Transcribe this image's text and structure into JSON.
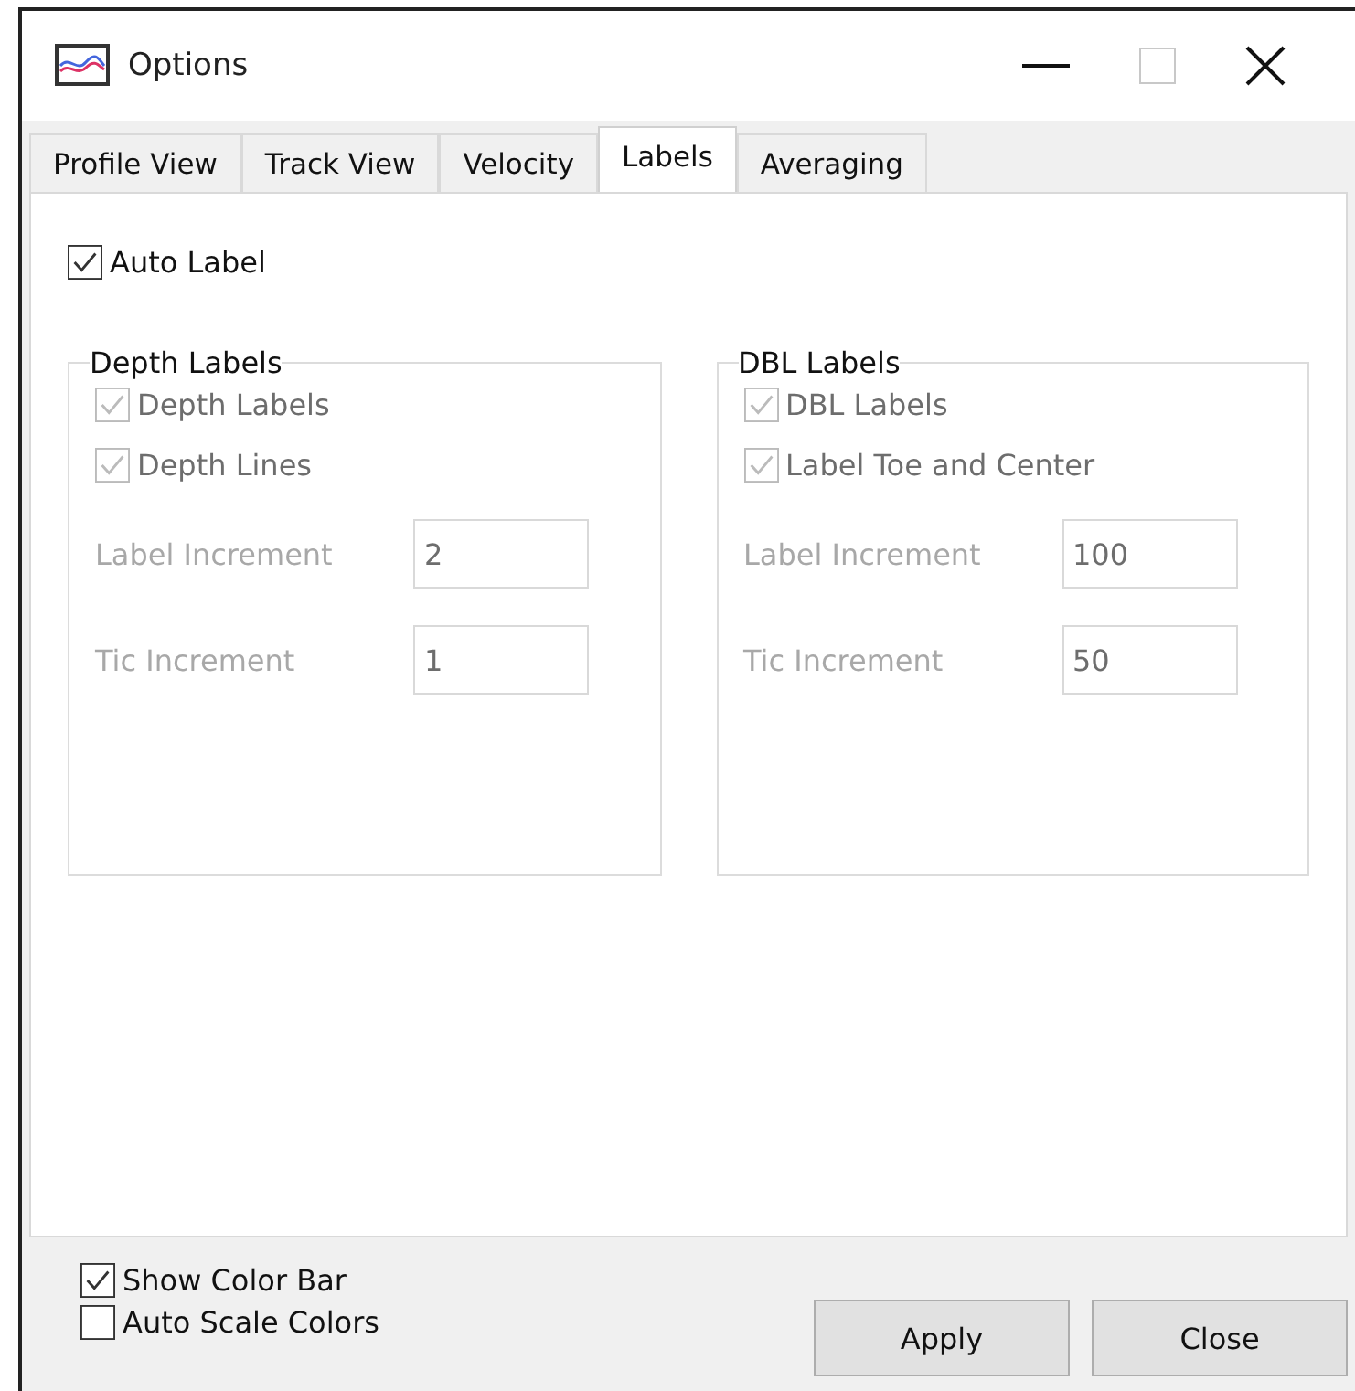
{
  "window": {
    "title": "Options"
  },
  "tabs": [
    {
      "label": "Profile View",
      "selected": false
    },
    {
      "label": "Track View",
      "selected": false
    },
    {
      "label": "Velocity",
      "selected": false
    },
    {
      "label": "Labels",
      "selected": true
    },
    {
      "label": "Averaging",
      "selected": false
    }
  ],
  "auto_label": {
    "label": "Auto Label",
    "checked": true
  },
  "groups": [
    {
      "title": "Depth Labels",
      "checkboxes": [
        {
          "label": "Depth Labels",
          "checked": true,
          "disabled": true
        },
        {
          "label": "Depth Lines",
          "checked": true,
          "disabled": true
        }
      ],
      "fields": [
        {
          "label": "Label Increment",
          "value": "2",
          "disabled": true
        },
        {
          "label": "Tic Increment",
          "value": "1",
          "disabled": true
        }
      ]
    },
    {
      "title": "DBL Labels",
      "checkboxes": [
        {
          "label": "DBL Labels",
          "checked": true,
          "disabled": true
        },
        {
          "label": "Label Toe and Center",
          "checked": true,
          "disabled": true
        }
      ],
      "fields": [
        {
          "label": "Label Increment",
          "value": "100",
          "disabled": true
        },
        {
          "label": "Tic Increment",
          "value": "50",
          "disabled": true
        }
      ]
    }
  ],
  "footer_checkboxes": [
    {
      "label": "Show Color Bar",
      "checked": true
    },
    {
      "label": "Auto Scale Colors",
      "checked": false
    }
  ],
  "buttons": [
    "Apply",
    "Close"
  ]
}
